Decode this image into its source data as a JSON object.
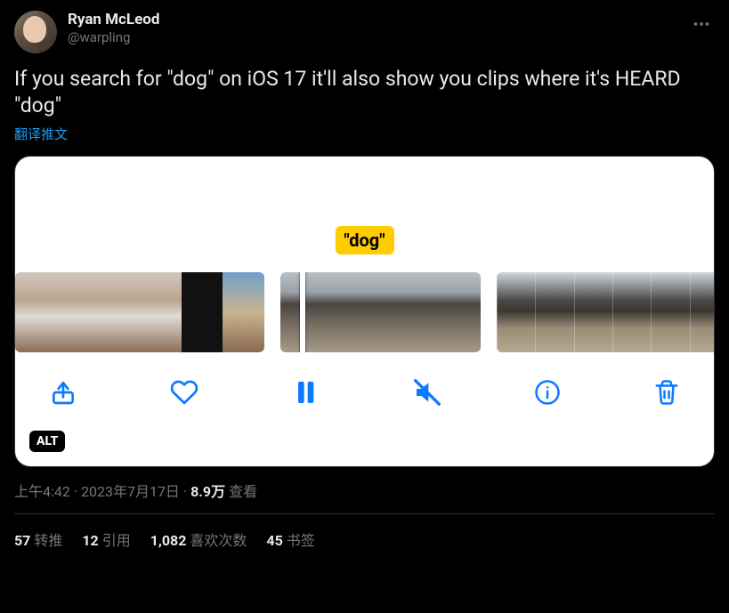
{
  "author": {
    "display_name": "Ryan McLeod",
    "handle": "@warpling"
  },
  "tweet_text": "If you search for \"dog\" on iOS 17 it'll also show you clips where it's HEARD \"dog\"",
  "translate_label": "翻译推文",
  "media": {
    "caption_pill": "\"dog\"",
    "alt_badge": "ALT",
    "toolbar": {
      "share": "share-icon",
      "like": "heart-icon",
      "pause": "pause-icon",
      "mute": "speaker-muted-icon",
      "info": "info-icon",
      "trash": "trash-icon"
    }
  },
  "meta": {
    "time": "上午4:42",
    "date": "2023年7月17日",
    "views_value": "8.9万",
    "views_label": "查看"
  },
  "stats": {
    "retweets": {
      "count": "57",
      "label": "转推"
    },
    "quotes": {
      "count": "12",
      "label": "引用"
    },
    "likes": {
      "count": "1,082",
      "label": "喜欢次数"
    },
    "bookmarks": {
      "count": "45",
      "label": "书签"
    }
  }
}
